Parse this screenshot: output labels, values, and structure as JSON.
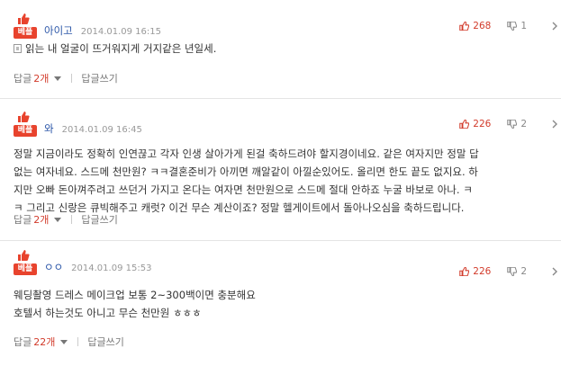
{
  "comments": [
    {
      "badge": "베플",
      "author": "아이고",
      "date": "2014.01.09 16:15",
      "up": "268",
      "down": "1",
      "lines": [
        "읽는 내 얼굴이 뜨거워지게 거지같은 년일세."
      ],
      "reply_label": "답글",
      "reply_count": "2개",
      "write_label": "답글쓰기"
    },
    {
      "badge": "베플",
      "author": "와",
      "date": "2014.01.09 16:45",
      "up": "226",
      "down": "2",
      "lines": [
        "정말 지금이라도 정확히 인연끊고 각자 인생 살아가게 된걸 축하드려야 할지경이네요. 같은 여자지만 정말 답",
        "없는 여자네요. 스드메 천만원? ㅋㅋ결혼준비가 아끼면 깨알같이 아낄순있어도. 올리면 한도 끝도 없지요. 하",
        "지만 오빠 돈아껴주려고 쓰던거 가지고 온다는 여자면 천만원으로 스드메 절대 안하죠 누굴 바보로 아나. ㅋ",
        "ㅋ 그리고 신랑은 큐빅해주고 캐럿? 이건 무슨 계산이죠? 정말 헬게이트에서 돌아나오심을 축하드립니다."
      ],
      "reply_label": "답글",
      "reply_count": "2개",
      "write_label": "답글쓰기"
    },
    {
      "badge": "베플",
      "author": "ㅇㅇ",
      "date": "2014.01.09 15:53",
      "up": "226",
      "down": "2",
      "lines": [
        "웨딩촬영 드레스 메이크업 보통 2~300백이면 충분해요",
        "호텔서 하는것도 아니고 무슨 천만원 ㅎㅎㅎ"
      ],
      "reply_label": "답글",
      "reply_count": "22개",
      "write_label": "답글쓰기"
    }
  ],
  "colors": {
    "badge": "#e8432d",
    "up": "#d23b2b",
    "author": "#2b56a8"
  },
  "icons": {
    "badge_thumb": "thumbs-up-icon",
    "up": "thumbs-up-icon",
    "down": "thumbs-down-icon",
    "more": "chevron-right-icon",
    "mobile": "mobile-icon"
  }
}
